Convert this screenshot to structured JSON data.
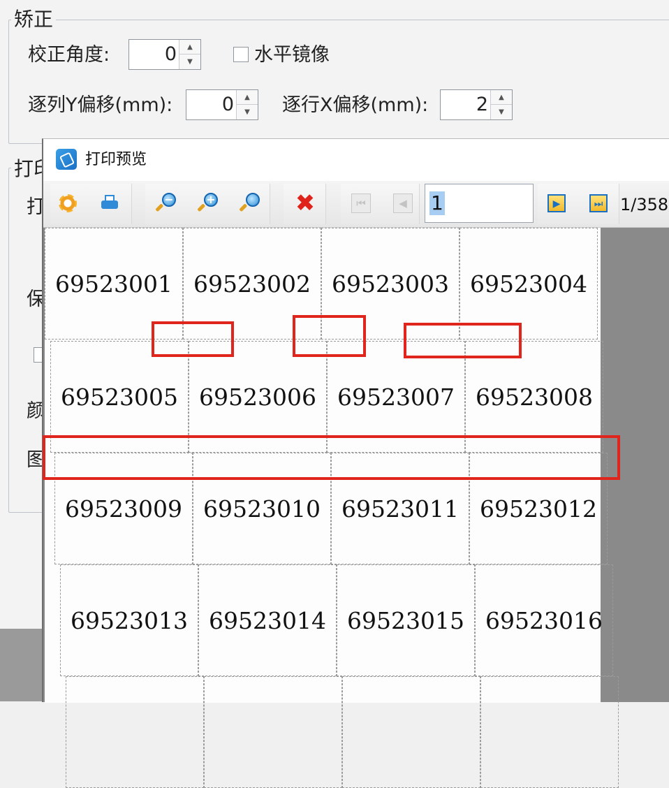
{
  "settings": {
    "group_correction": "矫正",
    "correction_angle_label": "校正角度:",
    "correction_angle_value": "0",
    "mirror_label": "水平镜像",
    "col_y_offset_label": "逐列Y偏移(mm):",
    "col_y_offset_value": "0",
    "row_x_offset_label": "逐行X偏移(mm):",
    "row_x_offset_value": "2",
    "group_print_partial": "打印",
    "side_chars": [
      "打",
      "保",
      "颜",
      "图"
    ]
  },
  "preview": {
    "title": "打印预览",
    "page_input": "1",
    "page_count": "1/358",
    "toolbar": {
      "settings_icon": "gear-icon",
      "print_icon": "printer-icon",
      "zoom_out_icon": "zoom-out-icon",
      "zoom_in_icon": "zoom-in-icon",
      "zoom_fit_icon": "zoom-fit-icon",
      "close_icon": "close-icon",
      "first_icon": "first-page-icon",
      "prev_icon": "prev-page-icon",
      "next_icon": "next-page-icon",
      "last_icon": "last-page-icon"
    },
    "labels": [
      "69523001",
      "69523002",
      "69523003",
      "69523004",
      "69523005",
      "69523006",
      "69523007",
      "69523008",
      "69523009",
      "69523010",
      "69523011",
      "69523012",
      "69523013",
      "69523014",
      "69523015",
      "69523016"
    ],
    "highlight_color": "#e0251c"
  }
}
